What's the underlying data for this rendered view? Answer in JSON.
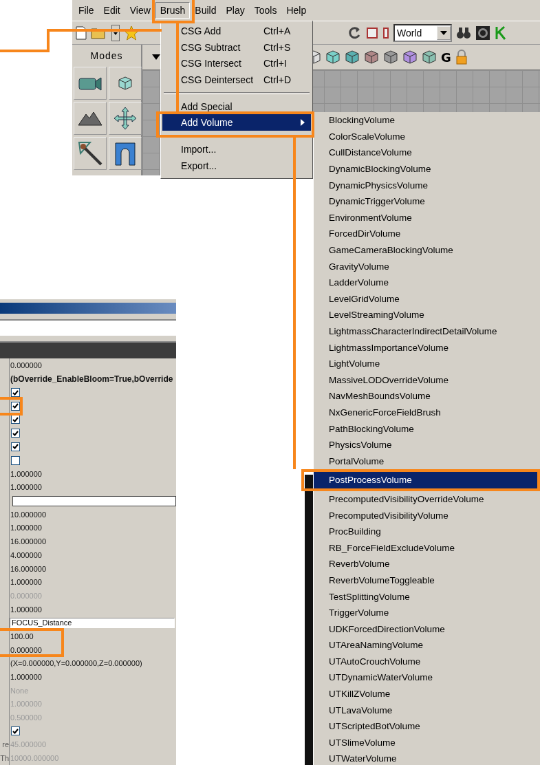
{
  "editor": {
    "menu_bar": [
      {
        "label": "File",
        "selected": false
      },
      {
        "label": "Edit",
        "selected": false
      },
      {
        "label": "View",
        "selected": false
      },
      {
        "label": "Brush",
        "selected": true
      },
      {
        "label": "Build",
        "selected": false
      },
      {
        "label": "Play",
        "selected": false
      },
      {
        "label": "Tools",
        "selected": false
      },
      {
        "label": "Help",
        "selected": false
      }
    ],
    "toolbar": {
      "coordinate_dropdown": "World"
    },
    "viewport_toolbar": {
      "glyph": "G"
    },
    "modes": {
      "title": "Modes"
    }
  },
  "brush_menu": {
    "items": [
      {
        "kind": "command",
        "label": "CSG Add",
        "shortcut": "Ctrl+A",
        "selected": false
      },
      {
        "kind": "command",
        "label": "CSG Subtract",
        "shortcut": "Ctrl+S",
        "selected": false
      },
      {
        "kind": "command",
        "label": "CSG Intersect",
        "shortcut": "Ctrl+I",
        "selected": false
      },
      {
        "kind": "command",
        "label": "CSG Deintersect",
        "shortcut": "Ctrl+D",
        "selected": false
      },
      {
        "kind": "separator"
      },
      {
        "kind": "command",
        "label": "Add Special",
        "selected": false
      },
      {
        "kind": "submenu",
        "label": "Add Volume",
        "selected": true
      },
      {
        "kind": "separator"
      },
      {
        "kind": "command",
        "label": "Import...",
        "selected": false
      },
      {
        "kind": "command",
        "label": "Export...",
        "selected": false
      }
    ]
  },
  "volume_menu": {
    "items": [
      {
        "label": "BlockingVolume",
        "selected": false
      },
      {
        "label": "ColorScaleVolume",
        "selected": false
      },
      {
        "label": "CullDistanceVolume",
        "selected": false
      },
      {
        "label": "DynamicBlockingVolume",
        "selected": false
      },
      {
        "label": "DynamicPhysicsVolume",
        "selected": false
      },
      {
        "label": "DynamicTriggerVolume",
        "selected": false
      },
      {
        "label": "EnvironmentVolume",
        "selected": false
      },
      {
        "label": "ForcedDirVolume",
        "selected": false
      },
      {
        "label": "GameCameraBlockingVolume",
        "selected": false
      },
      {
        "label": "GravityVolume",
        "selected": false
      },
      {
        "label": "LadderVolume",
        "selected": false
      },
      {
        "label": "LevelGridVolume",
        "selected": false
      },
      {
        "label": "LevelStreamingVolume",
        "selected": false
      },
      {
        "label": "LightmassCharacterIndirectDetailVolume",
        "selected": false
      },
      {
        "label": "LightmassImportanceVolume",
        "selected": false
      },
      {
        "label": "LightVolume",
        "selected": false
      },
      {
        "label": "MassiveLODOverrideVolume",
        "selected": false
      },
      {
        "label": "NavMeshBoundsVolume",
        "selected": false
      },
      {
        "label": "NxGenericForceFieldBrush",
        "selected": false
      },
      {
        "label": "PathBlockingVolume",
        "selected": false
      },
      {
        "label": "PhysicsVolume",
        "selected": false
      },
      {
        "label": "PortalVolume",
        "selected": false
      },
      {
        "label": "PostProcessVolume",
        "selected": true
      },
      {
        "label": "PrecomputedVisibilityOverrideVolume",
        "selected": false
      },
      {
        "label": "PrecomputedVisibilityVolume",
        "selected": false
      },
      {
        "label": "ProcBuilding",
        "selected": false
      },
      {
        "label": "RB_ForceFieldExcludeVolume",
        "selected": false
      },
      {
        "label": "ReverbVolume",
        "selected": false
      },
      {
        "label": "ReverbVolumeToggleable",
        "selected": false
      },
      {
        "label": "TestSplittingVolume",
        "selected": false
      },
      {
        "label": "TriggerVolume",
        "selected": false
      },
      {
        "label": "UDKForcedDirectionVolume",
        "selected": false
      },
      {
        "label": "UTAreaNamingVolume",
        "selected": false
      },
      {
        "label": "UTAutoCrouchVolume",
        "selected": false
      },
      {
        "label": "UTDynamicWaterVolume",
        "selected": false
      },
      {
        "label": "UTKillZVolume",
        "selected": false
      },
      {
        "label": "UTLavaVolume",
        "selected": false
      },
      {
        "label": "UTScriptedBotVolume",
        "selected": false
      },
      {
        "label": "UTSlimeVolume",
        "selected": false
      },
      {
        "label": "UTWaterVolume",
        "selected": false
      }
    ]
  },
  "properties": {
    "rows": [
      {
        "kind": "text",
        "value": "0.000000",
        "dimmed": false
      },
      {
        "kind": "bold",
        "value": "(bOverride_EnableBloom=True,bOverride"
      },
      {
        "kind": "checkbox",
        "checked": true
      },
      {
        "kind": "checkbox",
        "checked": true
      },
      {
        "kind": "checkbox",
        "checked": true
      },
      {
        "kind": "checkbox",
        "checked": true
      },
      {
        "kind": "checkbox",
        "checked": true
      },
      {
        "kind": "checkbox",
        "checked": false
      },
      {
        "kind": "text",
        "value": "1.000000",
        "dimmed": false
      },
      {
        "kind": "text",
        "value": "1.000000",
        "dimmed": false
      },
      {
        "kind": "field"
      },
      {
        "kind": "text",
        "value": "10.000000",
        "dimmed": false
      },
      {
        "kind": "text",
        "value": "1.000000",
        "dimmed": false
      },
      {
        "kind": "text",
        "value": "16.000000",
        "dimmed": false
      },
      {
        "kind": "text",
        "value": "4.000000",
        "dimmed": false
      },
      {
        "kind": "text",
        "value": "16.000000",
        "dimmed": false
      },
      {
        "kind": "text",
        "value": "1.000000",
        "dimmed": false
      },
      {
        "kind": "text",
        "value": "0.000000",
        "dimmed": true
      },
      {
        "kind": "text",
        "value": "1.000000",
        "dimmed": false
      },
      {
        "kind": "field",
        "value": "FOCUS_Distance"
      },
      {
        "kind": "text",
        "value": "100.00",
        "dimmed": false
      },
      {
        "kind": "text",
        "value": "0.000000",
        "dimmed": false
      },
      {
        "kind": "text",
        "value": "(X=0.000000,Y=0.000000,Z=0.000000)",
        "dimmed": false
      },
      {
        "kind": "text",
        "value": "1.000000",
        "dimmed": false
      },
      {
        "kind": "text",
        "value": "None",
        "dimmed": true
      },
      {
        "kind": "text",
        "value": "1.000000",
        "dimmed": true
      },
      {
        "kind": "text",
        "value": "0.500000",
        "dimmed": true
      },
      {
        "kind": "checkbox",
        "checked": true
      },
      {
        "kind": "text",
        "label": "re",
        "value": "45.000000",
        "dimmed": true
      },
      {
        "kind": "text",
        "label": "Th",
        "value": "10000.000000",
        "dimmed": true
      }
    ]
  }
}
